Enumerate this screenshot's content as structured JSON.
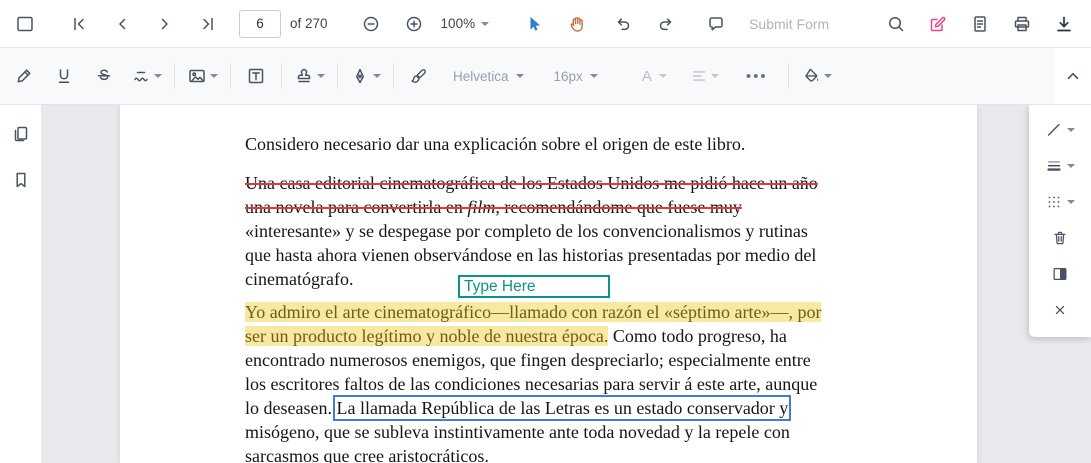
{
  "top_toolbar": {
    "page_input_value": "6",
    "page_count_label": "of 270",
    "zoom_value": "100%",
    "submit_form_label": "Submit Form"
  },
  "format_toolbar": {
    "font_family": "Helvetica",
    "font_size": "16px",
    "text_color_label": "A",
    "more_label": "•••"
  },
  "annotations": {
    "freetext_value": "Type Here"
  },
  "document": {
    "line1": "Considero necesario dar una explicación sobre el origen de este libro.",
    "strike1": "Una casa editorial cinematográfica de los Estados Unidos me pidió hace un año",
    "strike2a": "una novela para convertirla en ",
    "strike2b": "film",
    "strike2c": ", recomendándome que fuese muy",
    "line4": "«interesante» y se despegase por completo de los convencionalismos y rutinas",
    "line5": "que hasta ahora vienen observándose en las historias presentadas por medio del",
    "line6": "cinematógrafo.",
    "hl1": "Yo admiro el arte cinematográfico—llamado con razón el «séptimo arte»—, por",
    "hl2": "ser un producto legítimo y noble de nuestra época.",
    "line8b": " Como todo progreso, ha",
    "line9": "encontrado numerosos enemigos, que fingen despreciarlo; especialmente entre",
    "line10": "los escritores faltos de las condiciones necesarias para servir á este arte, aunque",
    "line11a": "lo deseasen. ",
    "line11b": "La llamada República de las Letras es un estado conservador y",
    "line12": "misógeno, que se subleva instintivamente ante toda novedad y la repele con",
    "line13": "sarcasmos que cree aristocráticos."
  },
  "icons": {
    "panel-toggle-icon": "▢",
    "first-page-icon": "|◀",
    "prev-page-icon": "◀",
    "next-page-icon": "▶",
    "last-page-icon": "▶|",
    "zoom-out-icon": "⊖",
    "zoom-in-icon": "⊕",
    "select-tool-icon": "➤",
    "pan-tool-icon": "✋",
    "undo-icon": "↶",
    "redo-icon": "↷",
    "comment-icon": "💬",
    "search-icon": "🔍",
    "form-edit-icon": "✎",
    "notes-icon": "🗎",
    "print-icon": "🖶",
    "download-icon": "⤓",
    "highlight-tool-icon": "🖍",
    "underline-tool-icon": "U",
    "strikeout-tool-icon": "S",
    "squiggly-tool-icon": "〜",
    "image-tool-icon": "🖼",
    "freetext-tool-icon": "T",
    "stamp-tool-icon": "stamp",
    "pen-tool-icon": "✒",
    "brush-tool-icon": "🖌",
    "fill-color-icon": "bucket",
    "collapse-icon": "⌃",
    "line-style-icon": "╱",
    "thickness-icon": "≡",
    "opacity-icon": "⠿",
    "delete-icon": "🗑",
    "layout-split-icon": "◧",
    "close-icon": "✕",
    "pages-icon": "🗐",
    "bookmark-icon": "🔖"
  },
  "colors": {
    "accent_blue": "#2f80c9",
    "pan_orange": "#c9703d",
    "edit_pink": "#e8468c",
    "strike_red": "#e5383b",
    "highlight_yellow": "#f7e8a2",
    "freetext_teal": "#0d9488",
    "rect_blue": "#3f7fd3"
  }
}
